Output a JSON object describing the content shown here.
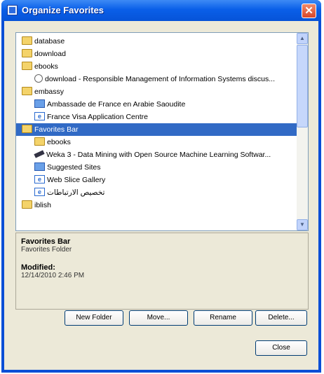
{
  "window": {
    "title": "Organize Favorites",
    "close_glyph": "✕"
  },
  "tree": {
    "items": [
      {
        "label": "database",
        "icon": "folder-icon",
        "level": 0
      },
      {
        "label": "download",
        "icon": "folder-icon",
        "level": 0
      },
      {
        "label": "ebooks",
        "icon": "folder-icon",
        "level": 0
      },
      {
        "label": "download - Responsible Management of Information Systems discus...",
        "icon": "page-icon",
        "level": 1
      },
      {
        "label": "embassy",
        "icon": "folder-icon",
        "level": 0
      },
      {
        "label": "Ambassade de France en Arabie Saoudite",
        "icon": "link-icon",
        "level": 1
      },
      {
        "label": "France Visa Application Centre",
        "icon": "ie-icon",
        "level": 1
      },
      {
        "label": "Favorites Bar",
        "icon": "folder-icon",
        "level": 0,
        "selected": true
      },
      {
        "label": "ebooks",
        "icon": "folder-icon",
        "level": 1
      },
      {
        "label": "Weka 3 - Data Mining with Open Source Machine Learning Softwar...",
        "icon": "weka-icon",
        "level": 1
      },
      {
        "label": "Suggested Sites",
        "icon": "link-icon",
        "level": 1
      },
      {
        "label": "Web Slice Gallery",
        "icon": "ie-icon",
        "level": 1
      },
      {
        "label": "تخصيص الارتباطات",
        "icon": "ie-icon",
        "level": 1
      },
      {
        "label": "iblish",
        "icon": "folder-icon",
        "level": 0
      }
    ]
  },
  "details": {
    "name": "Favorites Bar",
    "type": "Favorites Folder",
    "modified_label": "Modified:",
    "modified_value": "12/14/2010 2:46 PM"
  },
  "buttons": {
    "new_folder": "New Folder",
    "move": "Move...",
    "rename": "Rename",
    "delete": "Delete...",
    "close": "Close"
  },
  "scrollbar": {
    "up_glyph": "▲",
    "down_glyph": "▼"
  }
}
